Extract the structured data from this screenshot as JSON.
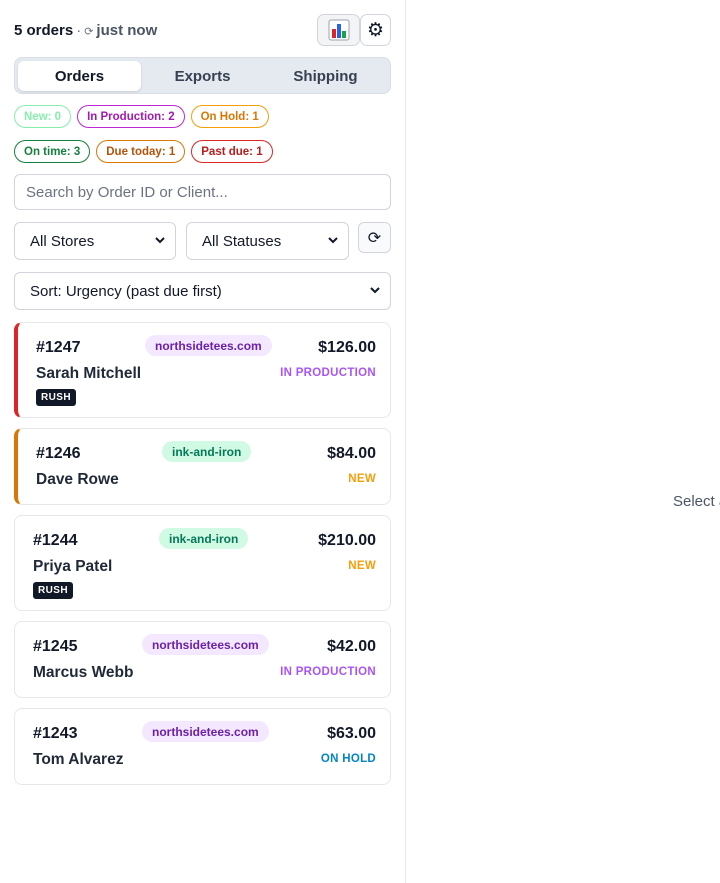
{
  "header": {
    "order_count": "5 orders",
    "separator": "·",
    "refresh_glyph": "⟳",
    "updated": "just now",
    "stats_icon": "bar-chart-icon",
    "settings_icon": "gear-icon"
  },
  "tabs": [
    {
      "label": "Orders",
      "active": true
    },
    {
      "label": "Exports",
      "active": false
    },
    {
      "label": "Shipping",
      "active": false
    }
  ],
  "status_pills": [
    {
      "label": "New: 0",
      "color": "#86efac",
      "text_color": "#86efac"
    },
    {
      "label": "In Production: 2",
      "color": "#c026d3",
      "text_color": "#a21caf"
    },
    {
      "label": "On Hold: 1",
      "color": "#f59e0b",
      "text_color": "#d97706"
    }
  ],
  "due_pills": [
    {
      "label": "On time: 3",
      "color": "#15803d",
      "text_color": "#15803d"
    },
    {
      "label": "Due today: 1",
      "color": "#d97706",
      "text_color": "#b45309"
    },
    {
      "label": "Past due: 1",
      "color": "#dc2626",
      "text_color": "#b91c1c"
    }
  ],
  "search": {
    "placeholder": "Search by Order ID or Client..."
  },
  "filters": {
    "store": "All Stores",
    "status": "All Statuses",
    "sort": "Sort: Urgency (past due first)"
  },
  "orders": [
    {
      "id": "#1247",
      "client": "Sarah Mitchell",
      "store": "northsidetees.com",
      "total": "$126.00",
      "status": "IN PRODUCTION",
      "status_color": "#a855f7",
      "rush": "RUSH",
      "accent": "#dc2626"
    },
    {
      "id": "#1246",
      "client": "Dave Rowe",
      "store": "ink-and-iron",
      "total": "$84.00",
      "status": "NEW",
      "status_color": "#f59e0b",
      "rush": "",
      "accent": "#d97706"
    },
    {
      "id": "#1244",
      "client": "Priya Patel",
      "store": "ink-and-iron",
      "total": "$210.00",
      "status": "NEW",
      "status_color": "#f59e0b",
      "rush": "RUSH",
      "accent": ""
    },
    {
      "id": "#1245",
      "client": "Marcus Webb",
      "store": "northsidetees.com",
      "total": "$42.00",
      "status": "IN PRODUCTION",
      "status_color": "#a855f7",
      "rush": "",
      "accent": ""
    },
    {
      "id": "#1243",
      "client": "Tom Alvarez",
      "store": "northsidetees.com",
      "total": "$63.00",
      "status": "ON HOLD",
      "status_color": "#0284c7",
      "rush": "",
      "accent": ""
    }
  ],
  "detail": {
    "hint": "Select a"
  }
}
